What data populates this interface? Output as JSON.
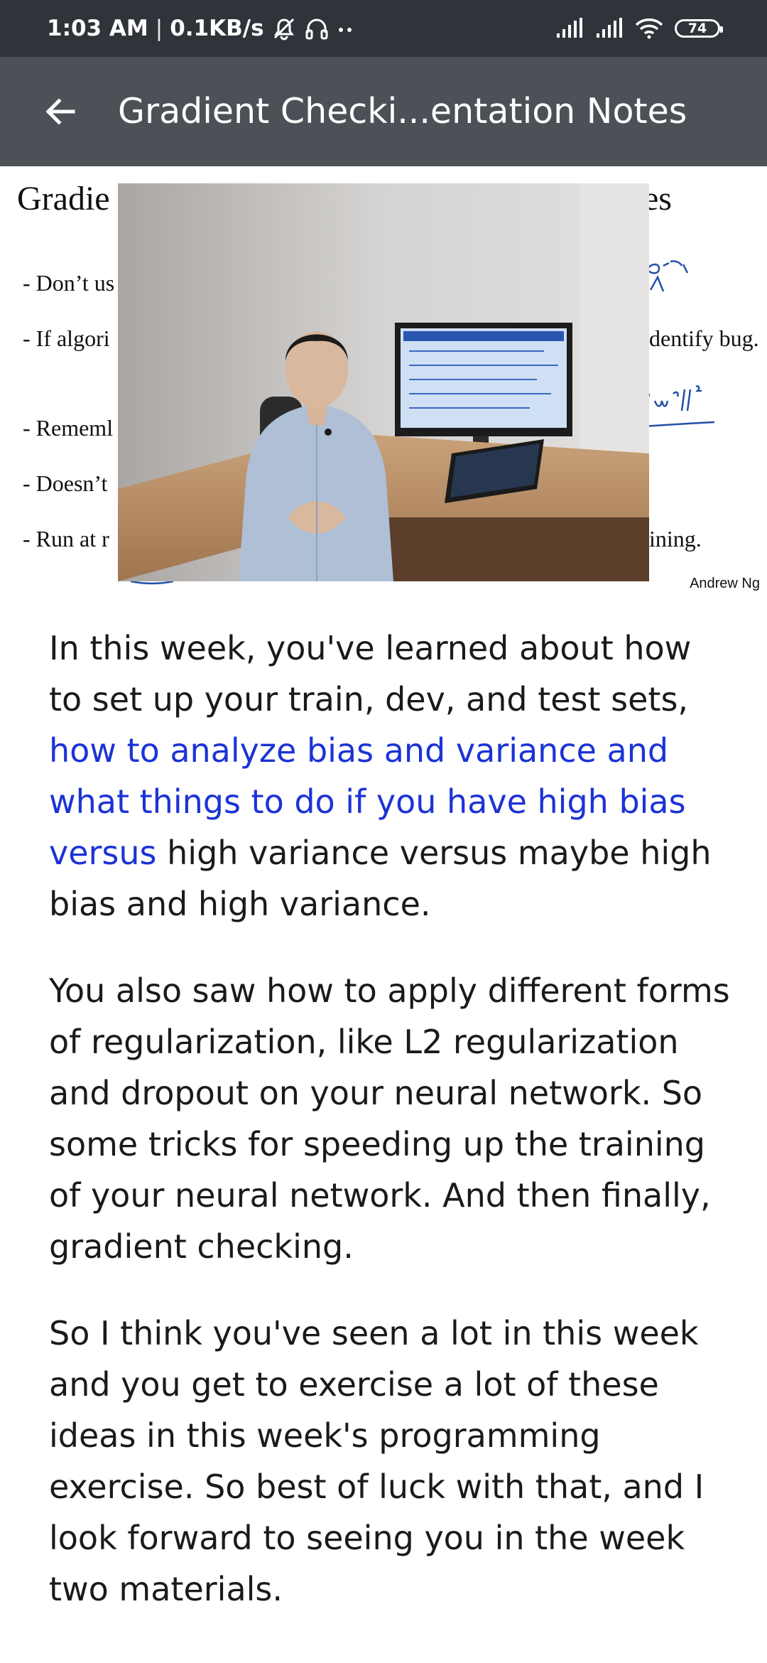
{
  "status_bar": {
    "time": "1:03 AM",
    "separator": "|",
    "speed": "0.1KB/s",
    "icons": [
      "mute-icon",
      "headset-icon",
      "more-dots-icon",
      "signal-icon",
      "signal-icon",
      "wifi-icon",
      "battery-icon"
    ],
    "battery_level": "74"
  },
  "app_bar": {
    "back_icon": "arrow-left-icon",
    "title": "Gradient Checki...entation Notes"
  },
  "slide": {
    "title_left": "Gradie",
    "title_right": "es",
    "lines_left": [
      "- Don’t us",
      "- If algori",
      "- Rememl",
      "- Doesn’t",
      "- Run at r"
    ],
    "tails_right": [
      "dentify bug.",
      "ining."
    ],
    "credit": "Andrew Ng",
    "accent_color": "#2350a8"
  },
  "video": {
    "description_icon": "lecture-video"
  },
  "transcript": {
    "p1_before": "In this week, you've learned about how to set up your train, dev, and test sets, ",
    "p1_highlight": "how to analyze bias and variance and what things to do if you have high bias versus",
    "p1_after": " high variance versus maybe high bias and high variance.",
    "p2": "You also saw how to apply different forms of regularization, like L2 regularization and dropout on your neural network. So some tricks for speeding up the training of your neural network. And then finally, gradient checking.",
    "p3": "So I think you've seen a lot in this week and you get to exercise a lot of these ideas in this week's programming exercise. So best of luck with that, and I look forward to seeing you in the week two materials.",
    "highlight_color": "#1b33d6"
  }
}
